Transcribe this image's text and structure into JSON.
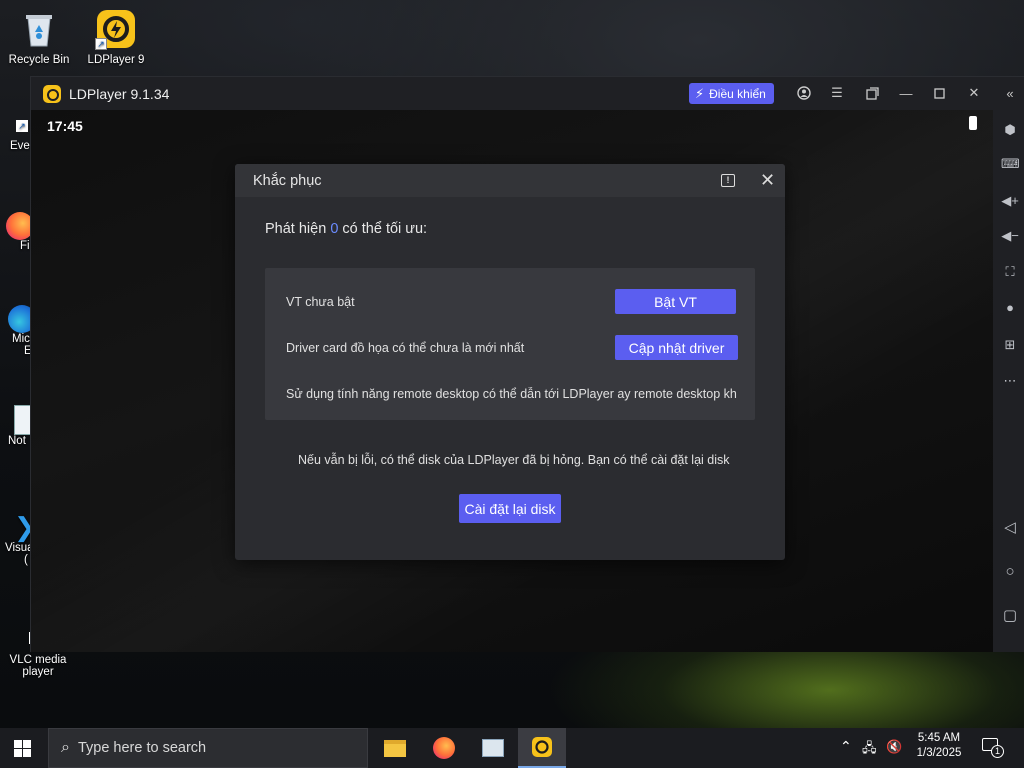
{
  "desktop": {
    "icons": [
      {
        "label": "Recycle Bin"
      },
      {
        "label": "LDPlayer 9"
      }
    ],
    "partial_labels": [
      "Eve",
      "Fi",
      "Mic",
      "E",
      "Not",
      "Visua",
      "(",
      "VLC media",
      "player"
    ]
  },
  "ldplayer": {
    "title": "LDPlayer 9.1.34",
    "control_button": "Điều khiển",
    "clock": "17:45"
  },
  "dialog": {
    "title": "Khắc phục",
    "detect_prefix": "Phát hiện ",
    "detect_count": "0",
    "detect_suffix": " có thể tối ưu:",
    "issues": [
      {
        "text": "VT chưa bật",
        "button": "Bật VT"
      },
      {
        "text": "Driver card đồ họa có thể chưa là mới nhất",
        "button": "Cập nhật driver"
      },
      {
        "text": "Sử dụng tính năng remote desktop có thể dẫn tới LDPlayer ay remote desktop kh"
      }
    ],
    "footer_note": "Nếu vẫn bị lỗi, có thể disk của LDPlayer đã bị hỏng. Bạn có thể cài đặt lại disk",
    "reinstall_button": "Cài đặt lại disk"
  },
  "taskbar": {
    "search_placeholder": "Type here to search",
    "time": "5:45 AM",
    "date": "1/3/2025",
    "notification_count": "1"
  },
  "colors": {
    "accent": "#5b5ef0",
    "highlight_number": "#6b8cff",
    "dialog_bg": "#2b2c30"
  }
}
